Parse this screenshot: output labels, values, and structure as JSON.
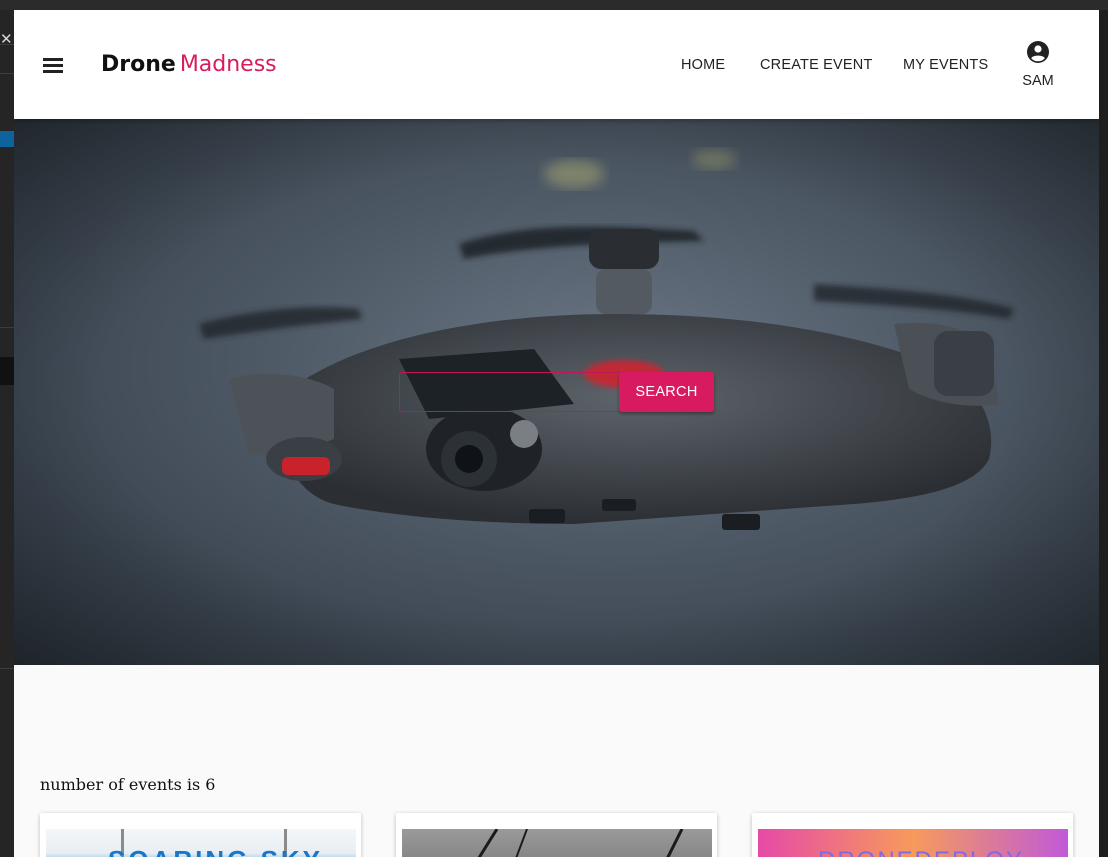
{
  "brand": {
    "name_bold": "Drone",
    "name_accent": "Madness",
    "accent_color": "#d81b60"
  },
  "nav": {
    "home": "HOME",
    "create_event": "CREATE EVENT",
    "my_events": "MY EVENTS",
    "account_label": "SAM"
  },
  "icons": {
    "menu": "hamburger-menu-icon",
    "account": "account-circle-icon"
  },
  "search": {
    "value": "",
    "placeholder": "",
    "button_label": "SEARCH"
  },
  "events": {
    "count_text": "number of events is 6",
    "cards": [
      {
        "thumb_text": "SOARING SKY"
      },
      {
        "thumb_text": ""
      },
      {
        "thumb_text": "DRONEDEPLOY"
      }
    ]
  }
}
